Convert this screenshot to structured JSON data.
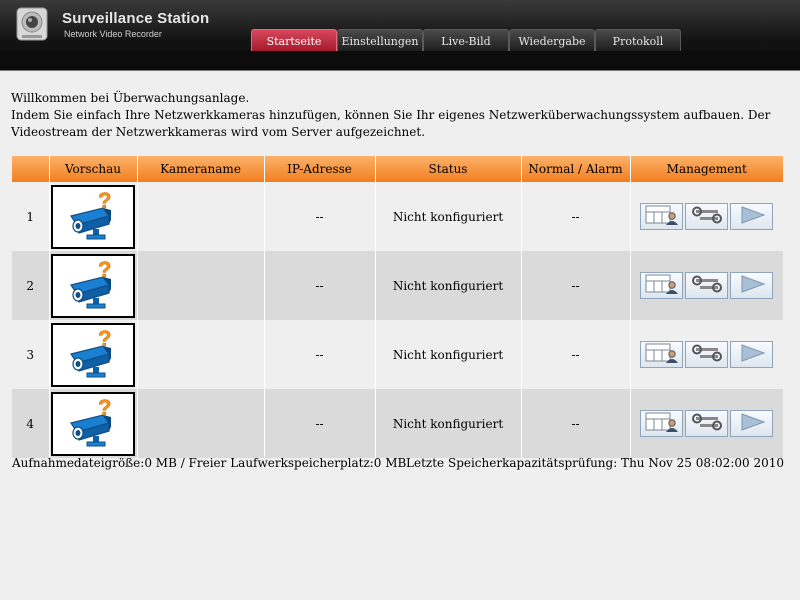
{
  "header": {
    "title": "Surveillance Station",
    "subtitle": "Network Video Recorder",
    "tabs": [
      {
        "label": "Startseite",
        "active": true
      },
      {
        "label": "Einstellungen",
        "active": false
      },
      {
        "label": "Live-Bild",
        "active": false
      },
      {
        "label": "Wiedergabe",
        "active": false
      },
      {
        "label": "Protokoll",
        "active": false
      }
    ]
  },
  "intro": {
    "line1": "Willkommen bei Überwachungsanlage.",
    "line2": "Indem Sie einfach Ihre Netzwerkkameras hinzufügen, können Sie Ihr eigenes Netzwerküberwachungssystem aufbauen. Der Videostream der Netzwerkkameras wird vom Server aufgezeichnet."
  },
  "table": {
    "columns": [
      "",
      "Vorschau",
      "Kameraname",
      "IP-Adresse",
      "Status",
      "Normal / Alarm",
      "Management"
    ],
    "rows": [
      {
        "num": "1",
        "name": "",
        "ip": "--",
        "status": "Nicht konfiguriert",
        "alarm": "--"
      },
      {
        "num": "2",
        "name": "",
        "ip": "--",
        "status": "Nicht konfiguriert",
        "alarm": "--"
      },
      {
        "num": "3",
        "name": "",
        "ip": "--",
        "status": "Nicht konfiguriert",
        "alarm": "--"
      },
      {
        "num": "4",
        "name": "",
        "ip": "--",
        "status": "Nicht konfiguriert",
        "alarm": "--"
      }
    ]
  },
  "footer": {
    "left": "Aufnahmedateigröße:0 MB / Freier Laufwerkspeicherplatz:0 MB",
    "right": "Letzte Speicherkapazitätsprüfung: Thu Nov 25 08:02:00 2010"
  },
  "icons": {
    "logo": "camera-logo-icon",
    "preview": "unknown-camera-icon",
    "management": [
      "camera-view-icon",
      "settings-wrench-icon",
      "play-icon"
    ]
  },
  "colors": {
    "active_tab": "#c12b40",
    "table_header": "#f79a44",
    "camera_blue": "#1a7fd0",
    "question_orange": "#f7941d"
  }
}
